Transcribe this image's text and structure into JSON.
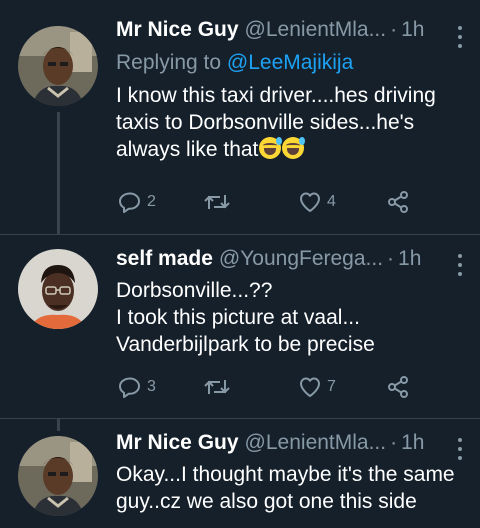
{
  "colors": {
    "background": "#15202b",
    "secondary_text": "#8899a6",
    "mention": "#1da1f2",
    "thread_line": "#38444d"
  },
  "tweets": [
    {
      "name": "Mr Nice Guy",
      "handle": "@LenientMla...",
      "separator": "·",
      "time": "1h",
      "replying_prefix": "Replying to ",
      "replying_to": "@LeeMajikija",
      "text": "I know this taxi driver....hes driving\ntaxis to Dorbsonville sides...he's\nalways like that",
      "emojis": [
        "sweat-smile-emoji",
        "sweat-smile-emoji"
      ],
      "reply_count": "2",
      "retweet_count": "",
      "like_count": "4",
      "avatar_icon": "profile-photo-avatar"
    },
    {
      "name": "self made",
      "handle": "@YoungFerega...",
      "separator": "·",
      "time": "1h",
      "text": "Dorbsonville...??\nI took this picture at vaal...\nVanderbijlpark to be precise",
      "reply_count": "3",
      "retweet_count": "",
      "like_count": "7",
      "avatar_icon": "profile-photo-avatar"
    },
    {
      "name": "Mr Nice Guy",
      "handle": "@LenientMla...",
      "separator": "·",
      "time": "1h",
      "text": "Okay...I thought maybe it's the same\nguy..cz we also got one this side",
      "avatar_icon": "profile-photo-avatar"
    }
  ],
  "icons": {
    "reply": "reply-icon",
    "retweet": "retweet-icon",
    "like": "heart-icon",
    "share": "share-icon",
    "more": "more-options-icon"
  }
}
